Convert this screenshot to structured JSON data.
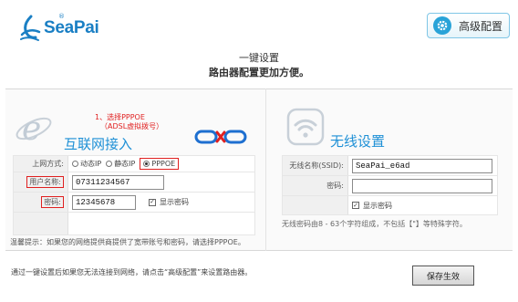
{
  "header": {
    "brand": "SeaPai",
    "registered_mark": "®",
    "advanced_button": "高级配置"
  },
  "headline": {
    "line1": "一键设置",
    "line2": "路由器配置更加方便。"
  },
  "wan": {
    "hint_line1": "1、选择PPPOE",
    "hint_line2": "（ADSL虚拟拨号）",
    "title": "互联网接入",
    "access_mode_label": "上网方式:",
    "modes": [
      {
        "label": "动态IP",
        "selected": false
      },
      {
        "label": "静态IP",
        "selected": false
      },
      {
        "label": "PPPOE",
        "selected": true
      }
    ],
    "username_label": "用户名称:",
    "username_value": "07311234567",
    "password_label": "密码:",
    "password_value": "12345678",
    "show_password_label": "显示密码",
    "show_password_checked": true,
    "tip": "温馨提示：如果您的网络提供商提供了宽带账号和密码，请选择PPPOE。"
  },
  "wireless": {
    "title": "无线设置",
    "ssid_label": "无线名称(SSID):",
    "ssid_value": "SeaPai_e6ad",
    "password_label": "密码:",
    "password_value": "",
    "show_password_label": "显示密码",
    "show_password_checked": true,
    "tip": "无线密码由8 - 63个字符组成，不包括【\"】等特殊字符。"
  },
  "footer": {
    "note": "通过一键设置后如果您无法连接到网络，请点击“高级配置”来设置路由器。",
    "save_button": "保存生效"
  },
  "colors": {
    "brand": "#1a7fc4",
    "title_blue": "#1e90d6",
    "hint_red": "#e02020"
  },
  "icons": [
    "seapai-logo-icon",
    "gear-icon",
    "ie-browser-icon",
    "chain-link-icon",
    "wifi-icon",
    "checkbox-icon",
    "radio-icon"
  ]
}
